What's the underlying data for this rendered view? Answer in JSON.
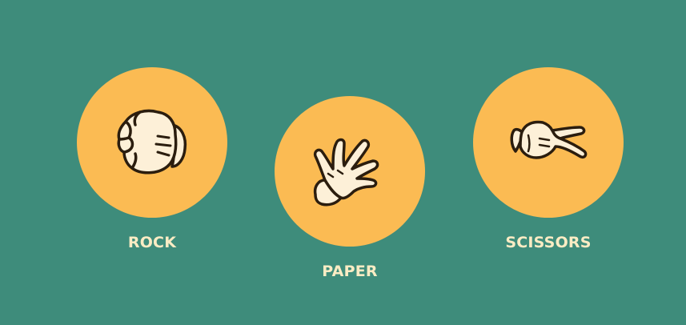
{
  "choices": [
    {
      "id": "rock",
      "label": "ROCK",
      "icon": "rock-fist-icon"
    },
    {
      "id": "paper",
      "label": "PAPER",
      "icon": "paper-open-hand-icon"
    },
    {
      "id": "scissors",
      "label": "SCISSORS",
      "icon": "scissors-two-fingers-icon"
    }
  ],
  "colors": {
    "background": "#3e8c7b",
    "circle": "#fbbb53",
    "label": "#fbecc4",
    "glove": "#fdf0d8",
    "outline": "#2b1d0e"
  }
}
